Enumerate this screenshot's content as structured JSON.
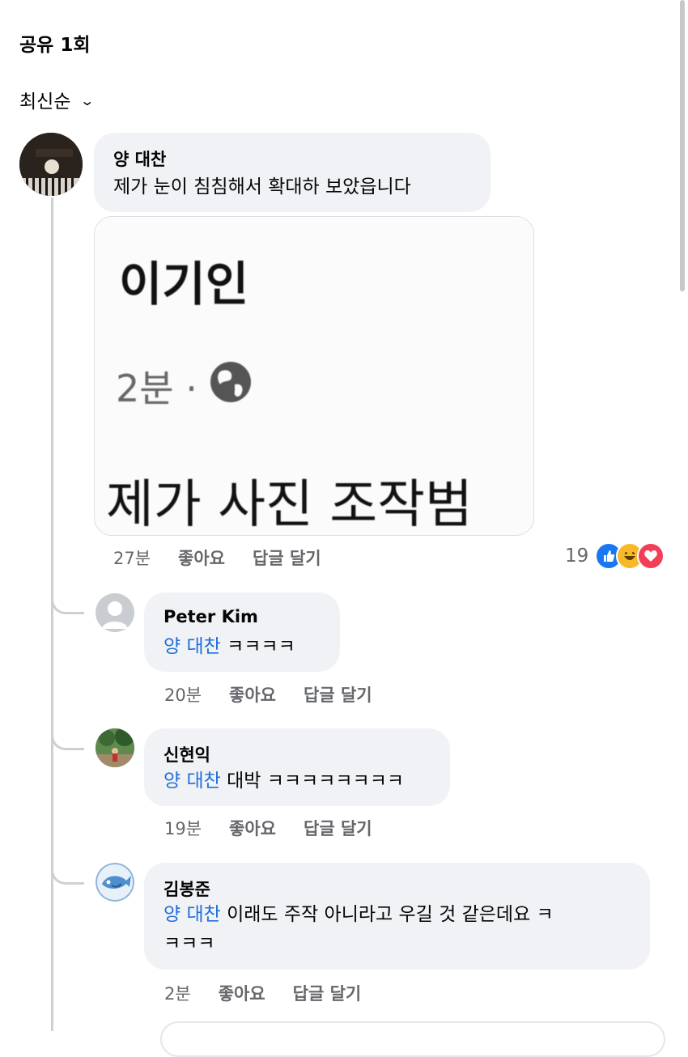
{
  "header": {
    "share_count": "공유 1회",
    "sort_label": "최신순"
  },
  "main_comment": {
    "author": "양 대찬",
    "text": "제가 눈이 침침해서 확대하 보았읍니다",
    "photo": {
      "name": "이기인",
      "time": "2분 ·",
      "post_text": "제가 사진 조작범"
    },
    "time": "27분",
    "like_label": "좋아요",
    "reply_label": "답글 달기",
    "reaction_count": "19",
    "reaction_icons": [
      "like-icon",
      "haha-icon",
      "love-icon"
    ],
    "reaction_colors": {
      "like": "#1877f2",
      "haha": "#f7b928",
      "love": "#f33e58"
    }
  },
  "replies": [
    {
      "author": "Peter Kim",
      "mention": "양 대찬",
      "text": " ㅋㅋㅋㅋ",
      "time": "20분",
      "like_label": "좋아요",
      "reply_label": "답글 달기"
    },
    {
      "author": "신현익",
      "mention": "양 대찬",
      "text": " 대박 ㅋㅋㅋㅋㅋㅋㅋㅋ",
      "time": "19분",
      "like_label": "좋아요",
      "reply_label": "답글 달기"
    },
    {
      "author": "김봉준",
      "mention": "양 대찬",
      "text": " 이래도 주작 아니라고 우길 것 같은데요 ㅋ",
      "text_line2": "ㅋㅋㅋ",
      "time": "2분",
      "like_label": "좋아요",
      "reply_label": "답글 달기"
    }
  ],
  "colors": {
    "accent": "#216fdb",
    "bubble": "#f0f2f5",
    "meta": "#65676b"
  }
}
